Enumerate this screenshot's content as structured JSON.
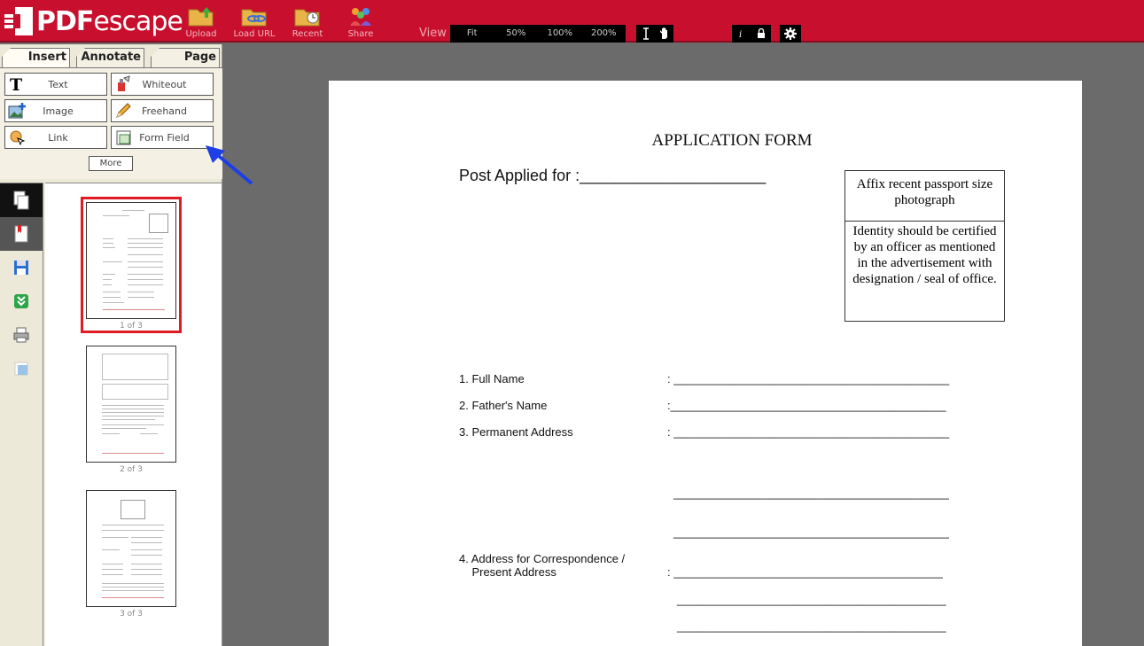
{
  "app": {
    "logo_text": "PDF",
    "logo_text_esc": "escape"
  },
  "toolbar": {
    "buttons": [
      {
        "label": "Upload",
        "icon": "folder-upload-icon"
      },
      {
        "label": "Load URL",
        "icon": "folder-link-icon"
      },
      {
        "label": "Recent",
        "icon": "folder-clock-icon"
      },
      {
        "label": "Share",
        "icon": "users-icon"
      }
    ],
    "view_label": "View",
    "zoom": [
      "Fit",
      "50%",
      "100%",
      "200%"
    ]
  },
  "sidebar": {
    "tabs": [
      "Insert",
      "Annotate",
      "Page"
    ],
    "tools": [
      "Text",
      "Whiteout",
      "Image",
      "Freehand",
      "Link",
      "Form Field"
    ],
    "more_label": "More",
    "thumbnails": [
      "1 of 3",
      "2 of 3",
      "3 of 3"
    ]
  },
  "document": {
    "title": "APPLICATION FORM",
    "post_applied": "Post Applied for  :_____________________",
    "photo_top": "Affix recent passport size photograph",
    "photo_bottom": "Identity should be certified by an officer as mentioned in the advertisement with designation / seal of office.",
    "fields": [
      {
        "label": "1. Full Name",
        "line": ": ___________________________________________"
      },
      {
        "label": "2. Father's Name",
        "line": ":___________________________________________"
      },
      {
        "label": "3. Permanent Address",
        "line": ": ___________________________________________"
      },
      {
        "label": "",
        "line": "___________________________________________"
      },
      {
        "label": "",
        "line": "___________________________________________"
      },
      {
        "label": "4. Address for Correspondence /",
        "line": ":  __________________________________________"
      },
      {
        "label": "    Present Address",
        "line": ""
      },
      {
        "label": "",
        "line": "__________________________________________"
      },
      {
        "label": "",
        "line": "__________________________________________"
      }
    ]
  },
  "colors": {
    "brand": "#c8102e",
    "arrow": "#1e3fe6",
    "selection": "#e01b24"
  }
}
